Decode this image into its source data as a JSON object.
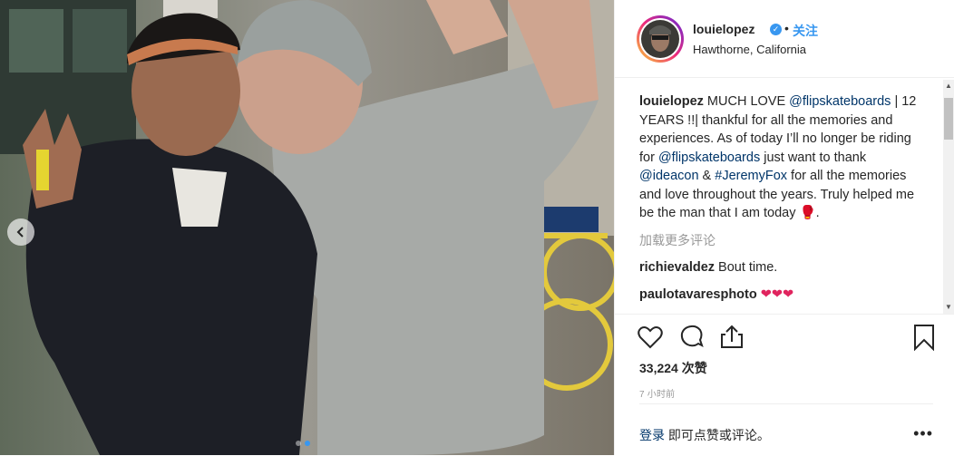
{
  "post": {
    "username": "louielopez",
    "follow_label": "关注",
    "separator": "•",
    "location": "Hawthorne, California",
    "caption": {
      "username": "louielopez",
      "text_1": " MUCH LOVE ",
      "mention_1": "@flipskateboards",
      "text_2": " | 12 YEARS !!| thankful for all the memories and experiences. As of today I’ll no longer be riding for ",
      "mention_2": "@flipskateboards",
      "text_3": " just want to thank ",
      "mention_3": "@ideacon",
      "text_4": " & ",
      "hashtag_1": "#JeremyFox",
      "text_5": " for all the memories and love throughout the years. Truly helped me be the man that I am today ",
      "emoji": "🥊",
      "text_6": "."
    },
    "load_more": "加载更多评论",
    "comments": [
      {
        "user": "richievaldez",
        "text": "Bout time."
      },
      {
        "user": "paulotavaresphoto",
        "text": "❤❤❤"
      }
    ],
    "likes": "33,224 次赞",
    "timestamp": "7 小时前",
    "footer": {
      "login": "登录",
      "rest": " 即可点赞或评论。",
      "more": "•••"
    },
    "carousel": {
      "total": 2,
      "active": 1
    }
  },
  "icons": [
    "heart-icon",
    "comment-icon",
    "share-icon",
    "bookmark-icon",
    "chevron-left-icon",
    "verified-icon"
  ],
  "colors": {
    "link": "#003569",
    "accent": "#3897f0",
    "muted": "#999999",
    "border": "#efefef"
  }
}
